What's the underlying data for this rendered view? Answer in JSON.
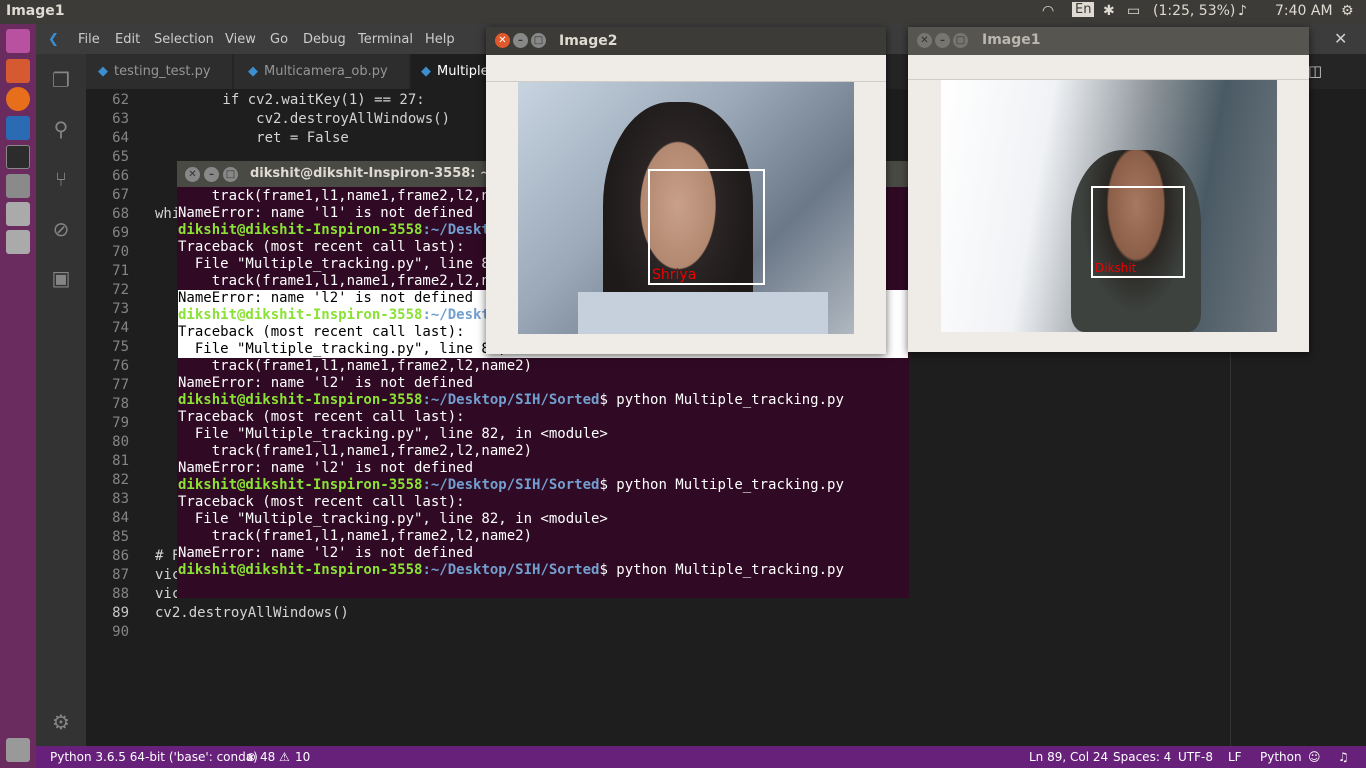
{
  "topbar": {
    "title": "Image1",
    "lang": "En",
    "battery": "(1:25, 53%)",
    "time": "7:40 AM"
  },
  "menu": [
    "File",
    "Edit",
    "Selection",
    "View",
    "Go",
    "Debug",
    "Terminal",
    "Help"
  ],
  "tabs": [
    {
      "label": "testing_test.py"
    },
    {
      "label": "Multicamera_ob.py"
    },
    {
      "label": "Multiple"
    }
  ],
  "editor": {
    "lines": [
      {
        "n": "62",
        "code": "        if cv2.waitKey(1) == 27:"
      },
      {
        "n": "63",
        "code": "            cv2.destroyAllWindows()"
      },
      {
        "n": "64",
        "code": "            ret = False"
      },
      {
        "n": "65",
        "code": ""
      },
      {
        "n": "66",
        "code": ""
      },
      {
        "n": "67",
        "code": ""
      },
      {
        "n": "68",
        "code": "whi"
      },
      {
        "n": "69",
        "code": ""
      },
      {
        "n": "70",
        "code": ""
      },
      {
        "n": "71",
        "code": ""
      },
      {
        "n": "72",
        "code": ""
      },
      {
        "n": "73",
        "code": ""
      },
      {
        "n": "74",
        "code": ""
      },
      {
        "n": "75",
        "code": ""
      },
      {
        "n": "76",
        "code": ""
      },
      {
        "n": "77",
        "code": ""
      },
      {
        "n": "78",
        "code": ""
      },
      {
        "n": "79",
        "code": ""
      },
      {
        "n": "80",
        "code": ""
      },
      {
        "n": "81",
        "code": ""
      },
      {
        "n": "82",
        "code": ""
      },
      {
        "n": "83",
        "code": ""
      },
      {
        "n": "84",
        "code": ""
      },
      {
        "n": "85",
        "code": ""
      },
      {
        "n": "86",
        "code": "# F"
      },
      {
        "n": "87",
        "code": "vic"
      },
      {
        "n": "88",
        "code": "vic"
      },
      {
        "n": "89",
        "code": "cv2.destroyAllWindows()"
      },
      {
        "n": "90",
        "code": ""
      }
    ]
  },
  "terminal": {
    "title": "dikshit@dikshit-Inspiron-3558: ~",
    "lines": [
      {
        "t": "    track(frame1,l1,name1,frame2,l2,name2)"
      },
      {
        "t": "NameError: name 'l1' is not defined"
      },
      {
        "user": "dikshit@dikshit-Inspiron-3558",
        "path": ":~/Desktop/SIH/Sorted",
        "cmd": "$ python Multiple_tracking.py"
      },
      {
        "t": "Traceback (most recent call last):"
      },
      {
        "t": "  File \"Multiple_tracking.py\", line 82, in <module>"
      },
      {
        "t": "    track(frame1,l1,name1,frame2,l2,name2)"
      },
      {
        "t": "NameError: name 'l2' is not defined",
        "hl": true
      },
      {
        "user": "dikshit@dikshit-Inspiron-3558",
        "path": ":~/Desktop/SIH/Sorted",
        "cmd": "$ python Multiple_tracking.py",
        "hl": true
      },
      {
        "t": "Traceback (most recent call last):",
        "hl": true
      },
      {
        "t": "  File \"Multiple_tracking.py\", line 82, in <module>",
        "hl": true
      },
      {
        "t": "    track(frame1,l1,name1,frame2,l2,name2)"
      },
      {
        "t": "NameError: name 'l2' is not defined"
      },
      {
        "user": "dikshit@dikshit-Inspiron-3558",
        "path": ":~/Desktop/SIH/Sorted",
        "cmd": "$ python Multiple_tracking.py"
      },
      {
        "t": "Traceback (most recent call last):"
      },
      {
        "t": "  File \"Multiple_tracking.py\", line 82, in <module>"
      },
      {
        "t": "    track(frame1,l1,name1,frame2,l2,name2)"
      },
      {
        "t": "NameError: name 'l2' is not defined"
      },
      {
        "user": "dikshit@dikshit-Inspiron-3558",
        "path": ":~/Desktop/SIH/Sorted",
        "cmd": "$ python Multiple_tracking.py"
      },
      {
        "t": "Traceback (most recent call last):"
      },
      {
        "t": "  File \"Multiple_tracking.py\", line 82, in <module>"
      },
      {
        "t": "    track(frame1,l1,name1,frame2,l2,name2)"
      },
      {
        "t": "NameError: name 'l2' is not defined"
      },
      {
        "user": "dikshit@dikshit-Inspiron-3558",
        "path": ":~/Desktop/SIH/Sorted",
        "cmd": "$ python Multiple_tracking.py"
      }
    ]
  },
  "image2": {
    "title": "Image2",
    "label": "Shriya"
  },
  "image1": {
    "title": "Image1",
    "label": "Dikshit"
  },
  "status": {
    "python": "Python 3.6.5 64-bit ('base': conda)",
    "errors": "48",
    "warnings": "10",
    "pos": "Ln 89, Col 24",
    "spaces": "Spaces: 4",
    "enc": "UTF-8",
    "eol": "LF",
    "lang": "Python"
  },
  "colors": {
    "accent": "#68217a",
    "launcher": "#6a2b5f",
    "terminal_bg": "#300a24"
  }
}
